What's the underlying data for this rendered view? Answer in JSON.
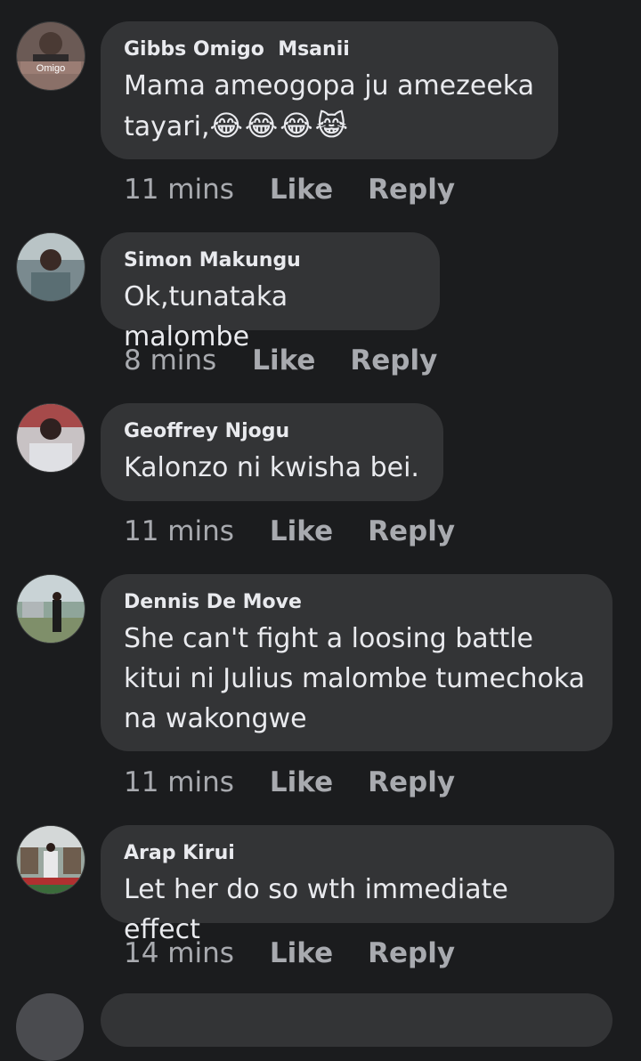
{
  "comments": [
    {
      "name": "Gibbs Omigo  Msanii",
      "avatar_caption": "Omigo",
      "text": "Mama ameogopa ju amezeeka tayari,",
      "emoji": "😂😂😂😹",
      "time": "11 mins",
      "like": "Like",
      "reply": "Reply"
    },
    {
      "name": "Simon Makungu",
      "text": "Ok,tunataka malombe",
      "time": "8 mins",
      "like": "Like",
      "reply": "Reply"
    },
    {
      "name": "Geoffrey Njogu",
      "text": "Kalonzo ni kwisha bei.",
      "time": "11 mins",
      "like": "Like",
      "reply": "Reply"
    },
    {
      "name": "Dennis De Move",
      "text": "She can't fight a loosing battle kitui ni Julius malombe tumechoka na wakongwe",
      "time": "11 mins",
      "like": "Like",
      "reply": "Reply"
    },
    {
      "name": "Arap Kirui",
      "text": "Let her do so wth immediate effect",
      "time": "14 mins",
      "like": "Like",
      "reply": "Reply"
    }
  ],
  "colors": {
    "background": "#1b1c1e",
    "bubble": "#333436",
    "meta": "#a8aaaf",
    "text": "#e9eaee"
  }
}
